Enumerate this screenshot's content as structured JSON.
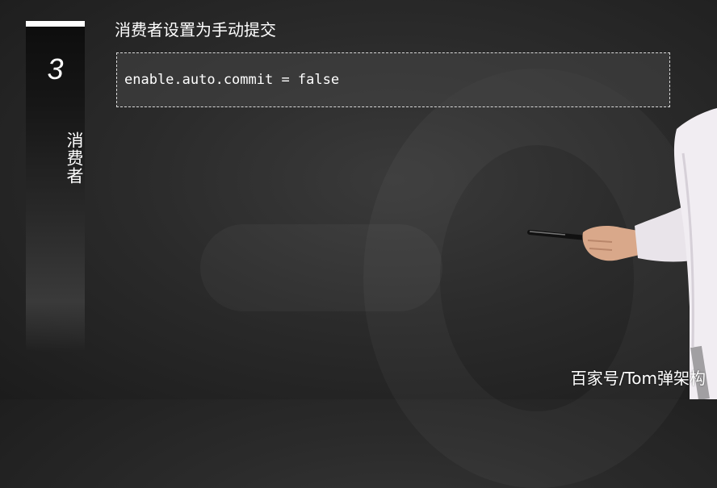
{
  "chapter": {
    "number": "3",
    "title": "消费者"
  },
  "slide": {
    "heading": "消费者设置为手动提交",
    "code": "enable.auto.commit = false"
  },
  "watermark": "百家号/Tom弹架构"
}
